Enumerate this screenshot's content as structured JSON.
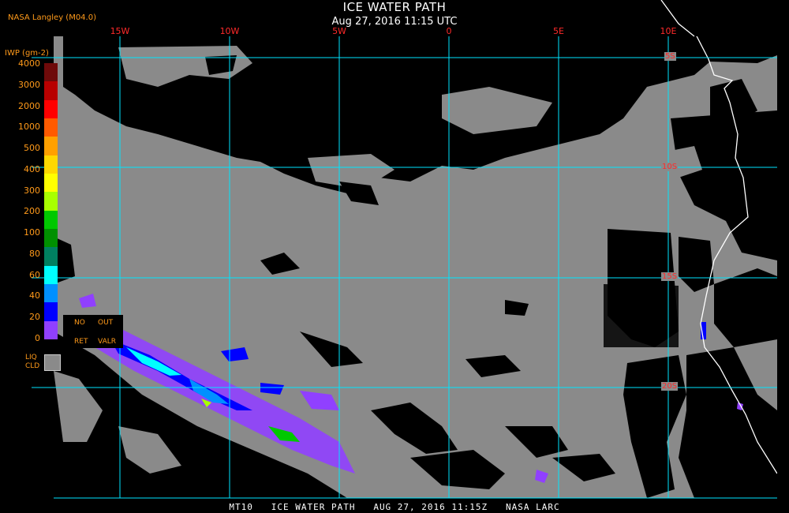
{
  "header": {
    "title": "ICE WATER PATH",
    "subtitle": "Aug 27, 2016 11:15 UTC",
    "credit": "NASA Langley (M04.0)"
  },
  "legend": {
    "unit_label": "IWP (gm-2)",
    "ticks": [
      "4000",
      "3000",
      "2000",
      "1000",
      "500",
      "400",
      "300",
      "200",
      "100",
      "80",
      "60",
      "40",
      "20",
      "0"
    ],
    "colors": [
      "#6e0a0a",
      "#b80000",
      "#ff0000",
      "#ff5a00",
      "#ffa000",
      "#ffd800",
      "#ffff00",
      "#a8ff00",
      "#00c800",
      "#009000",
      "#008060",
      "#00ffff",
      "#0090ff",
      "#0000ff",
      "#9040ff"
    ],
    "no_retrieval": {
      "line1_left": "NO",
      "line1_right": "OUT",
      "line2_left": "RET",
      "line2_right": "VALR"
    },
    "liquid": {
      "line1": "LIQ",
      "line2": "CLD"
    }
  },
  "grid": {
    "longitude_labels": [
      "15W",
      "10W",
      "5W",
      "0",
      "5E",
      "10E"
    ],
    "latitude_labels": [
      "5S",
      "10S",
      "15S",
      "20S"
    ]
  },
  "footer": "MT10   ICE WATER PATH   AUG 27, 2016 11:15Z   NASA LARC",
  "colors": {
    "liquid_cloud": "#8a8a8a",
    "clear": "#000000",
    "grid": "#00ffff",
    "coast": "#ffffff",
    "label_orange": "#ff9a1a",
    "label_red": "#ff2a2a"
  }
}
